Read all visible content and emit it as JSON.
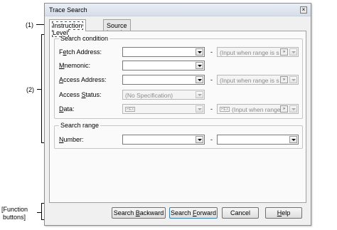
{
  "annotations": {
    "a1": "(1)",
    "a2": "(2)",
    "a3_line1": "[Function",
    "a3_line2": "buttons]"
  },
  "window": {
    "title": "Trace Search",
    "close_glyph": "×"
  },
  "tabs": [
    {
      "label": "Instruction Level"
    },
    {
      "label": "Source Level"
    }
  ],
  "search_condition": {
    "title": "Search condition",
    "fetch_address": {
      "label_pre": "F",
      "label_u": "e",
      "label_post": "tch Address:",
      "range_placeholder": "(Input when range is s"
    },
    "mnemonic": {
      "label_pre": "",
      "label_u": "M",
      "label_post": "nemonic:"
    },
    "access_address": {
      "label_pre": "",
      "label_u": "A",
      "label_post": "ccess Address:",
      "range_placeholder": "(Input when range is s"
    },
    "access_status": {
      "label_pre": "Access ",
      "label_u": "S",
      "label_post": "tatus:",
      "value": "(No Specification)"
    },
    "data": {
      "label_pre": "",
      "label_u": "D",
      "label_post": "ata:",
      "hex_badge": "HEX",
      "hex_badge2": "HEX",
      "range_placeholder": "(Input when range"
    }
  },
  "search_range": {
    "title": "Search range",
    "number": {
      "label_pre": "",
      "label_u": "N",
      "label_post": "umber:"
    }
  },
  "dash": "-",
  "pick_glyph": "»",
  "buttons": {
    "search_backward": {
      "pre": "Search ",
      "u": "B",
      "post": "ackward"
    },
    "search_forward": {
      "pre": "Search ",
      "u": "F",
      "post": "orward"
    },
    "cancel": {
      "label": "Cancel"
    },
    "help": {
      "pre": "",
      "u": "H",
      "post": "elp"
    }
  }
}
